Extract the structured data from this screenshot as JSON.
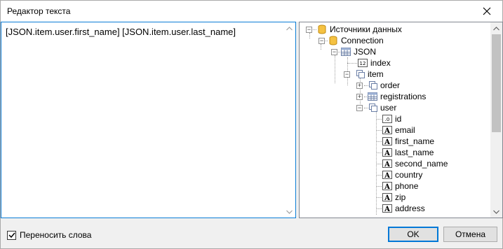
{
  "window": {
    "title": "Редактор текста"
  },
  "editor": {
    "text": "[JSON.item.user.first_name] [JSON.item.user.last_name]"
  },
  "tree": {
    "root": "Источники данных",
    "connection": "Connection",
    "json": "JSON",
    "index": "index",
    "item": "item",
    "order": "order",
    "registrations": "registrations",
    "user": "user",
    "fields": [
      "id",
      "email",
      "first_name",
      "last_name",
      "second_name",
      "country",
      "phone",
      "zip",
      "address"
    ]
  },
  "footer": {
    "word_wrap_label": "Переносить слова",
    "word_wrap_checked": true,
    "ok_label": "OK",
    "cancel_label": "Отмена"
  },
  "colors": {
    "accent": "#0078d7",
    "db_icon": "#f5c242"
  }
}
